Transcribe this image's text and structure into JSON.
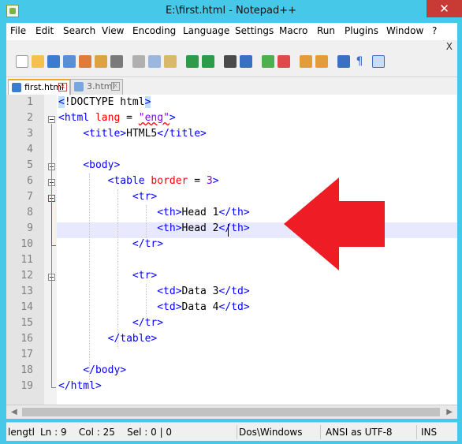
{
  "window": {
    "title": "E:\\first.html - Notepad++",
    "close_glyph": "✕"
  },
  "menu": [
    "File",
    "Edit",
    "Search",
    "View",
    "Encoding",
    "Language",
    "Settings",
    "Macro",
    "Run",
    "Plugins",
    "Window",
    "?"
  ],
  "menu_close": "X",
  "tabs": [
    {
      "label": "first.html",
      "active": true
    },
    {
      "label": "3.html",
      "active": false
    }
  ],
  "editor": {
    "current_line": 9,
    "line_numbers": [
      "1",
      "2",
      "3",
      "4",
      "5",
      "6",
      "7",
      "8",
      "9",
      "10",
      "11",
      "12",
      "13",
      "14",
      "15",
      "16",
      "17",
      "18",
      "19"
    ]
  },
  "code": [
    [
      {
        "t": "doctype-hl",
        "v": "<"
      },
      {
        "t": "doctype",
        "v": "!DOCTYPE html"
      },
      {
        "t": "doctype-hl",
        "v": ">"
      }
    ],
    [
      {
        "t": "tag",
        "v": "<html "
      },
      {
        "t": "attr",
        "v": "lang"
      },
      {
        "t": "text",
        "v": " = "
      },
      {
        "t": "val",
        "v": "\"eng\""
      },
      {
        "t": "tag",
        "v": ">"
      }
    ],
    [
      {
        "t": "text",
        "v": "    "
      },
      {
        "t": "tag",
        "v": "<title>"
      },
      {
        "t": "text",
        "v": "HTML5"
      },
      {
        "t": "tag",
        "v": "</title>"
      }
    ],
    [],
    [
      {
        "t": "text",
        "v": "    "
      },
      {
        "t": "tag",
        "v": "<body>"
      }
    ],
    [
      {
        "t": "text",
        "v": "        "
      },
      {
        "t": "tag",
        "v": "<table "
      },
      {
        "t": "attr",
        "v": "border"
      },
      {
        "t": "text",
        "v": " = "
      },
      {
        "t": "val",
        "v": "3"
      },
      {
        "t": "tag",
        "v": ">"
      }
    ],
    [
      {
        "t": "text",
        "v": "            "
      },
      {
        "t": "tag",
        "v": "<tr>"
      }
    ],
    [
      {
        "t": "text",
        "v": "                "
      },
      {
        "t": "tag",
        "v": "<th>"
      },
      {
        "t": "text",
        "v": "Head 1"
      },
      {
        "t": "tag",
        "v": "</th>"
      }
    ],
    [
      {
        "t": "text",
        "v": "                "
      },
      {
        "t": "tag",
        "v": "<th>"
      },
      {
        "t": "text",
        "v": "Head 2"
      },
      {
        "t": "tag",
        "v": "</th>"
      }
    ],
    [
      {
        "t": "text",
        "v": "            "
      },
      {
        "t": "tag",
        "v": "</tr>"
      }
    ],
    [],
    [
      {
        "t": "text",
        "v": "            "
      },
      {
        "t": "tag",
        "v": "<tr>"
      }
    ],
    [
      {
        "t": "text",
        "v": "                "
      },
      {
        "t": "tag",
        "v": "<td>"
      },
      {
        "t": "text",
        "v": "Data 3"
      },
      {
        "t": "tag",
        "v": "</td>"
      }
    ],
    [
      {
        "t": "text",
        "v": "                "
      },
      {
        "t": "tag",
        "v": "<td>"
      },
      {
        "t": "text",
        "v": "Data 4"
      },
      {
        "t": "tag",
        "v": "</td>"
      }
    ],
    [
      {
        "t": "text",
        "v": "            "
      },
      {
        "t": "tag",
        "v": "</tr>"
      }
    ],
    [
      {
        "t": "text",
        "v": "        "
      },
      {
        "t": "tag",
        "v": "</table>"
      }
    ],
    [],
    [
      {
        "t": "text",
        "v": "    "
      },
      {
        "t": "tag",
        "v": "</body>"
      }
    ],
    [
      {
        "t": "tag",
        "v": "</html>"
      }
    ]
  ],
  "status": {
    "length": "lengtl",
    "ln_col_sel": "Ln : 9    Col : 25    Sel : 0 | 0",
    "eol": "Dos\\Windows",
    "encoding": "ANSI as UTF-8",
    "mode": "INS"
  },
  "colors": {
    "tag": "#0000ff",
    "attr": "#ff0000",
    "value": "#8000ff",
    "arrow": "#ee1c25",
    "title_bar": "#46c8e8",
    "current_line": "#e8e8ff"
  }
}
